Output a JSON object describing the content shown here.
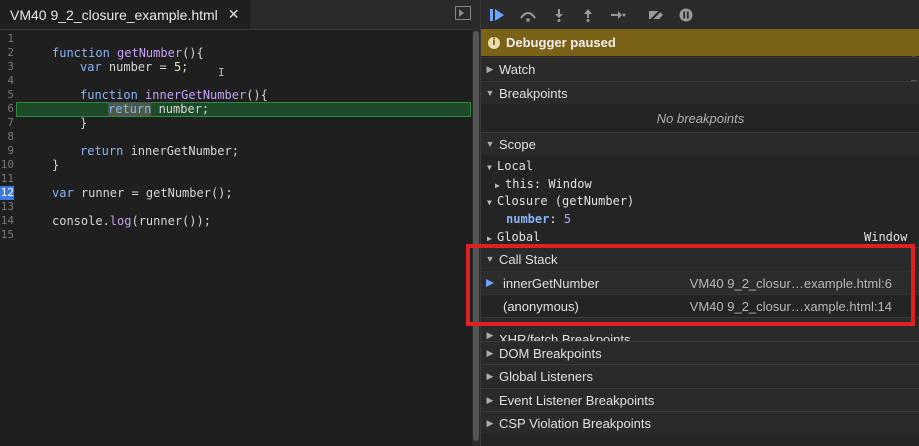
{
  "editor": {
    "tab_title": "VM40 9_2_closure_example.html",
    "tab_close": "✕",
    "line_numbers": [
      "1",
      "2",
      "3",
      "4",
      "5",
      "6",
      "7",
      "8",
      "9",
      "10",
      "11",
      "12",
      "13",
      "14",
      "15"
    ],
    "breakpoint_line": "12"
  },
  "debugger": {
    "paused_text": "Debugger paused",
    "sections": {
      "watch": "Watch",
      "breakpoints": "Breakpoints",
      "no_breakpoints": "No breakpoints",
      "scope": "Scope",
      "call_stack": "Call Stack",
      "xhr_partial": "XHR/fetch Breakpoints",
      "dom": "DOM Breakpoints",
      "global_listeners": "Global Listeners",
      "event_listener": "Event Listener Breakpoints",
      "csp": "CSP Violation Breakpoints"
    },
    "scope": {
      "local": "Local",
      "this_key": "this",
      "this_val": "Window",
      "closure": "Closure (getNumber)",
      "number_key": "number",
      "number_val": "5",
      "global": "Global",
      "global_val": "Window"
    },
    "call_stack": [
      {
        "fn": "innerGetNumber",
        "loc": "VM40 9_2_closur…example.html:6"
      },
      {
        "fn": "(anonymous)",
        "loc": "VM40 9_2_closur…xample.html:14"
      }
    ],
    "accent": "#6aa5ff",
    "paused_bg": "#7a6216",
    "highlight": "#e02020"
  }
}
